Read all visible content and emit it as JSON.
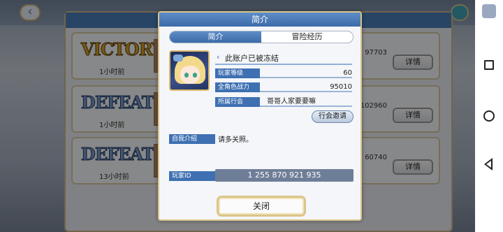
{
  "background": {
    "matches": [
      {
        "result": "VICTORY",
        "time": "1小时前",
        "score": "97703",
        "detail_label": "详情"
      },
      {
        "result": "DEFEAT",
        "time": "1小时前",
        "score": "102960",
        "detail_label": "详情"
      },
      {
        "result": "DEFEAT",
        "time": "13小时前",
        "score": "60740",
        "detail_label": "详情"
      }
    ]
  },
  "dialog": {
    "title": "简介",
    "tabs": [
      {
        "label": "简介",
        "active": true
      },
      {
        "label": "冒险经历",
        "active": false
      }
    ],
    "name": "此账户已被冻结",
    "fields": {
      "level_label": "玩家等级",
      "level_value": "60",
      "power_label": "全角色战力",
      "power_value": "95010",
      "guild_label": "所属行会",
      "guild_value": "哥哥人家要要嘛"
    },
    "guild_invite_label": "行会邀请",
    "intro_label": "自我介绍",
    "intro_value": "请多关照。",
    "player_id_label": "玩家ID",
    "player_id_value": "1 255 870 921 935",
    "close_label": "关闭"
  }
}
